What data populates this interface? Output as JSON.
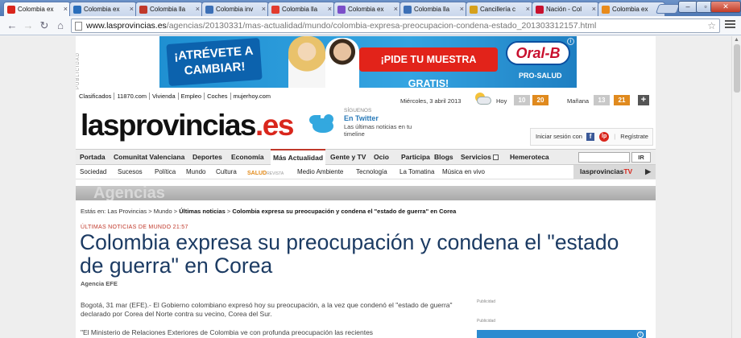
{
  "browser": {
    "tabs": [
      {
        "title": "Colombia ex",
        "favicon_color": "#d9261c",
        "active": true
      },
      {
        "title": "Colombia ex",
        "favicon_color": "#2a6ebb",
        "active": false
      },
      {
        "title": "Colombia lla",
        "favicon_color": "#c0392b",
        "active": false
      },
      {
        "title": "Colombia inv",
        "favicon_color": "#3b6fb6",
        "active": false
      },
      {
        "title": "Colombia lla",
        "favicon_color": "#e23b2e",
        "active": false
      },
      {
        "title": "Colombia ex",
        "favicon_color": "#7b4fc9",
        "active": false
      },
      {
        "title": "Colombia lla",
        "favicon_color": "#3b6fb6",
        "active": false
      },
      {
        "title": "Cancillería c",
        "favicon_color": "#d6a11d",
        "active": false
      },
      {
        "title": "Nación - Col",
        "favicon_color": "#c8102e",
        "active": false
      },
      {
        "title": "Colombia ex",
        "favicon_color": "#e88b1c",
        "active": false
      }
    ],
    "url_host": "www.lasprovincias.es",
    "url_path": "/agencias/20130331/mas-actualidad/mundo/colombia-expresa-preocupacion-condena-estado_201303312157.html"
  },
  "ad": {
    "label": "PUBLICIDAD",
    "left_text": "¡ATRÉVETE A CAMBIAR!",
    "cta": "¡PIDE TU MUESTRA GRATIS!",
    "brand": "Oral-B",
    "brand_sub": "PRO-SALUD",
    "info": "i"
  },
  "utility": {
    "links": [
      "Clasificados",
      "11870.com",
      "Vivienda",
      "Empleo",
      "Coches",
      "mujerhoy.com"
    ],
    "date": "Miércoles, 3 abril 2013",
    "today_label": "Hoy",
    "today_low": "10",
    "today_high": "20",
    "tomorrow_label": "Mañana",
    "tomorrow_low": "13",
    "tomorrow_high": "21",
    "plus": "+"
  },
  "masthead": {
    "logo_main": "lasprovincias",
    "logo_tld": ".es",
    "follow_kicker": "SÍGUENOS",
    "follow_title": "En Twitter",
    "follow_desc": "Las últimas noticias en tu timeline",
    "login": "Iniciar sesión con",
    "fb": "f",
    "lp": "lp",
    "register": "Regístrate"
  },
  "mainnav": {
    "items": [
      "Portada",
      "Comunitat Valenciana",
      "Deportes",
      "Economía",
      "Más Actualidad",
      "Gente y TV",
      "Ocio",
      "Participa",
      "Blogs",
      "Servicios",
      "Hemeroteca"
    ],
    "search_button": "IR"
  },
  "subnav": {
    "items": [
      "Sociedad",
      "Sucesos",
      "Política",
      "Mundo",
      "Cultura"
    ],
    "salud": "SALUD",
    "revista": "REVISTA",
    "items2": [
      "Medio Ambiente",
      "Tecnología",
      "La Tomatina",
      "Música en vivo"
    ],
    "tv_main": "lasprovincias",
    "tv_suffix": "TV"
  },
  "section": {
    "band": "Agencias"
  },
  "article": {
    "crumb_prefix": "Estás en:",
    "crumbs": [
      "Las Provincias",
      "Mundo",
      "Últimas noticias",
      "Colombia expresa su preocupación y condena el \"estado de guerra\" en Corea"
    ],
    "kicker": "ÚLTIMAS NOTICIAS DE MUNDO 21:57",
    "headline": "Colombia expresa su preocupación y condena el \"estado de guerra\" en Corea",
    "byline": "Agencia EFE",
    "para1": "Bogotá, 31 mar (EFE).- El Gobierno colombiano expresó hoy su preocupación, a la vez que condenó el \"estado de guerra\" declarado por Corea del Norte contra su vecino, Corea del Sur.",
    "para2": "\"El Ministerio de Relaciones Exteriores de Colombia ve con profunda preocupación las recientes",
    "side_pub1": "Publicidad",
    "side_pub2": "Publicidad"
  }
}
